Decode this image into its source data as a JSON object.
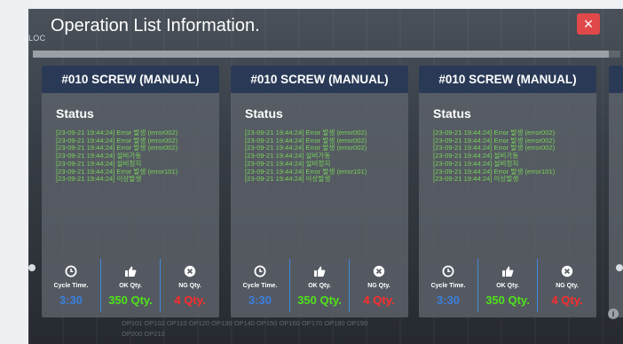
{
  "dialog": {
    "title": "Operation List Information.",
    "close_label": "×",
    "bg_label": "LOC",
    "progress_fraction": 0.98
  },
  "cards": [
    {
      "header": "#010 SCREW (MANUAL)",
      "status_title": "Status",
      "log": [
        "[23-09-21 19:44:24] Error 발생 (error002)",
        "[23-09-21 19:44:24] Error 발생 (error002)",
        "[23-09-21 19:44:24] Error 발생 (error002)",
        "[23-09-21 19:44:24] 설비가동",
        "[23-09-21 19:44:24] 설비정지",
        "[23-09-21 19:44:24] Error 발생 (error101)",
        "[23-09-21 19:44:24] 이상발생"
      ],
      "metrics": {
        "cycle_label": "Cycle Time.",
        "cycle_value": "3:30",
        "ok_label": "OK Qty.",
        "ok_value": "350 Qty.",
        "ng_label": "NG Qty.",
        "ng_value": "4 Qty."
      }
    },
    {
      "header": "#010 SCREW (MANUAL)",
      "status_title": "Status",
      "log": [
        "[23-09-21 19:44:24] Error 발생 (error002)",
        "[23-09-21 19:44:24] Error 발생 (error002)",
        "[23-09-21 19:44:24] Error 발생 (error002)",
        "[23-09-21 19:44:24] 설비가동",
        "[23-09-21 19:44:24] 설비정지",
        "[23-09-21 19:44:24] Error 발생 (error101)",
        "[23-09-21 19:44:24] 이상발생"
      ],
      "metrics": {
        "cycle_label": "Cycle Time.",
        "cycle_value": "3:30",
        "ok_label": "OK Qty.",
        "ok_value": "350 Qty.",
        "ng_label": "NG Qty.",
        "ng_value": "4 Qty."
      }
    },
    {
      "header": "#010 SCREW (MANUAL)",
      "status_title": "Status",
      "log": [
        "[23-09-21 19:44:24] Error 발생 (error002)",
        "[23-09-21 19:44:24] Error 발생 (error002)",
        "[23-09-21 19:44:24] Error 발생 (error002)",
        "[23-09-21 19:44:24] 설비가동",
        "[23-09-21 19:44:24] 설비정지",
        "[23-09-21 19:44:24] Error 발생 (error101)",
        "[23-09-21 19:44:24] 이상발생"
      ],
      "metrics": {
        "cycle_label": "Cycle Time.",
        "cycle_value": "3:30",
        "ok_label": "OK Qty.",
        "ok_value": "350 Qty.",
        "ng_label": "NG Qty.",
        "ng_value": "4 Qty."
      }
    }
  ],
  "icons": {
    "cycle": "clock-icon",
    "ok": "thumbs-up-icon",
    "ng": "x-circle-icon",
    "info": "info-icon"
  },
  "colors": {
    "header_bg": "#2a3a56",
    "log_text": "#78d25a",
    "cycle_value": "#3a7fe0",
    "ok_value": "#4fe21a",
    "ng_value": "#ff2b2b",
    "close_bg": "#e0484a"
  },
  "background_ops": {
    "row1": "OP101  OP102  OP110  OP120  OP130  OP140  OP150  OP160  OP170  OP180  OP190",
    "row2": "OP200  OP210"
  }
}
